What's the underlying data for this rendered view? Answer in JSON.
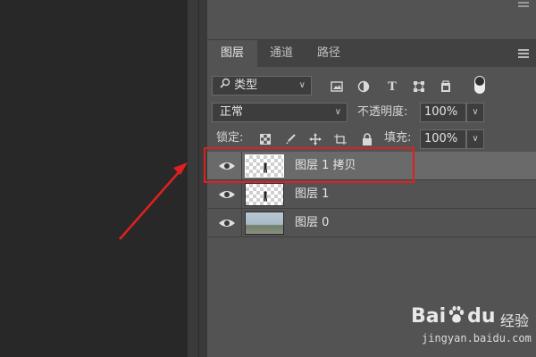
{
  "tabs": [
    {
      "label": "图层",
      "active": true
    },
    {
      "label": "通道",
      "active": false
    },
    {
      "label": "路径",
      "active": false
    }
  ],
  "filter": {
    "search_icon": "search-icon",
    "kind_label": "类型",
    "kind_icons": [
      "image-filter-icon",
      "adjustment-filter-icon",
      "type-filter-icon",
      "shape-filter-icon",
      "smart-object-filter-icon",
      "filter-toggle-icon"
    ]
  },
  "blend": {
    "mode": "正常",
    "opacity_label": "不透明度:",
    "opacity_value": "100%"
  },
  "lock": {
    "label": "锁定:",
    "icons": [
      "lock-transparent-pixels-icon",
      "lock-image-pixels-icon",
      "lock-position-icon",
      "artboard-nesting-icon",
      "lock-all-icon"
    ],
    "fill_label": "填充:",
    "fill_value": "100%"
  },
  "layers": [
    {
      "name": "图层 1 拷贝",
      "selected": true,
      "thumbnail": "transparent-with-figure"
    },
    {
      "name": "图层 1",
      "selected": false,
      "thumbnail": "transparent-with-figure"
    },
    {
      "name": "图层 0",
      "selected": false,
      "thumbnail": "photo"
    }
  ],
  "annotation": {
    "color": "#e02020"
  },
  "watermark": {
    "brand": "Bai",
    "brand2": "du",
    "jingyan": "经验",
    "url": "jingyan.baidu.com"
  }
}
